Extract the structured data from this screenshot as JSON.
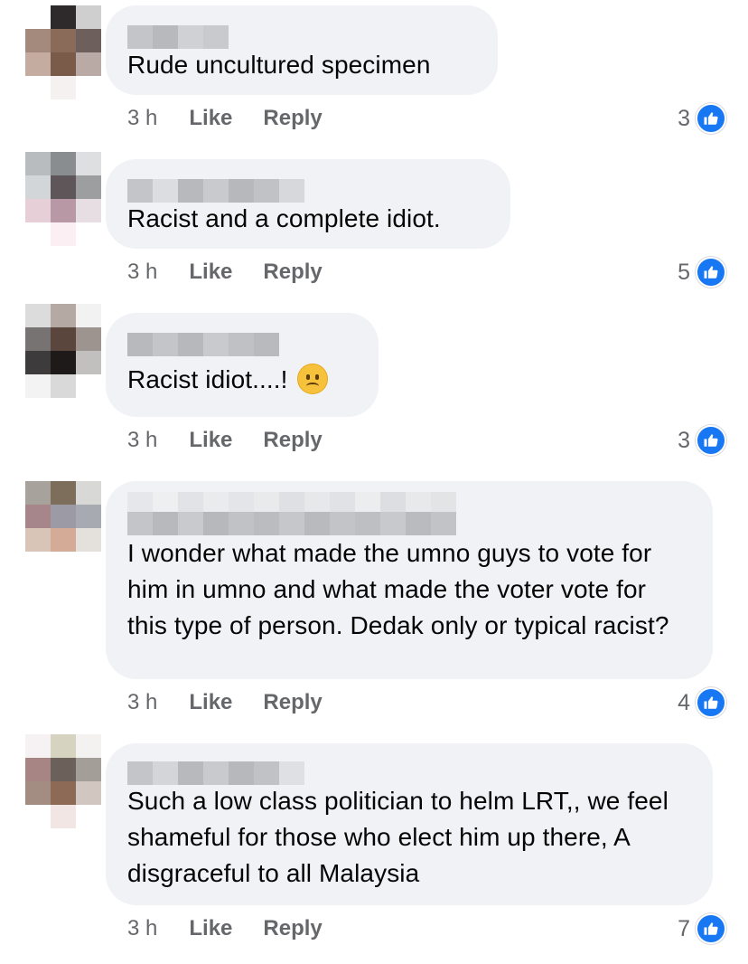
{
  "comments": [
    {
      "text": "Rude uncultured specimen",
      "time": "3 h",
      "like_label": "Like",
      "reply_label": "Reply",
      "reaction_count": "3"
    },
    {
      "text": "Racist and a complete idiot.",
      "time": "3 h",
      "like_label": "Like",
      "reply_label": "Reply",
      "reaction_count": "5"
    },
    {
      "text": "Racist idiot....!",
      "emoji": "frowning-face-icon",
      "time": "3 h",
      "like_label": "Like",
      "reply_label": "Reply",
      "reaction_count": "3"
    },
    {
      "text": "I wonder what made the umno guys to vote for him in umno and what made the voter vote for this type of person. Dedak only or typical racist?",
      "time": "3 h",
      "like_label": "Like",
      "reply_label": "Reply",
      "reaction_count": "4"
    },
    {
      "text": "Such a low class politician to helm LRT,, we feel shameful  for those who elect him up there, A disgraceful to all Malaysia",
      "time": "3 h",
      "like_label": "Like",
      "reply_label": "Reply",
      "reaction_count": "7"
    }
  ],
  "icons": {
    "reaction": "like-thumb-icon",
    "avatar": "blurred-avatar"
  },
  "colors": {
    "bubble": "#f0f2f5",
    "meta_text": "#65676b",
    "like_blue": "#1877f2"
  }
}
